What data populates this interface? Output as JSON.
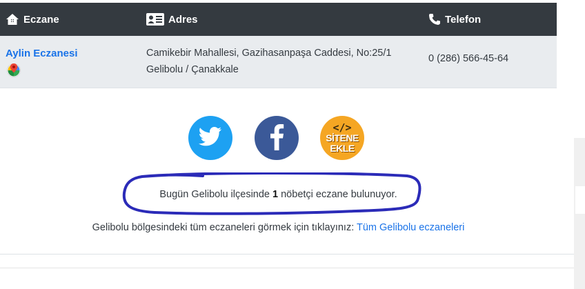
{
  "table": {
    "headers": {
      "eczane": "Eczane",
      "adres": "Adres",
      "telefon": "Telefon"
    },
    "rows": [
      {
        "name": "Aylin Eczanesi",
        "address_line1": "Camikebir Mahallesi, Gazihasanpaşa Caddesi, No:25/1",
        "address_line2": "Gelibolu / Çanakkale",
        "phone": "0 (286) 566-45-64"
      }
    ]
  },
  "social": {
    "twitter_icon": "twitter-icon",
    "facebook_icon": "facebook-icon",
    "site_badge_code": "</>",
    "site_badge_line1": "SİTENE",
    "site_badge_line2": "EKLE"
  },
  "summary": {
    "before": "Bugün Gelibolu ilçesinde ",
    "count": "1",
    "after": " nöbetçi eczane bulunuyor."
  },
  "info": {
    "text": "Gelibolu bölgesindeki tüm eczaneleri görmek için tıklayınız: ",
    "link": "Tüm Gelibolu eczaneleri"
  },
  "colors": {
    "header_bg": "#343a40",
    "row_bg": "#e9ecef",
    "link": "#1a73e8",
    "annotation": "#2b2bb8"
  }
}
